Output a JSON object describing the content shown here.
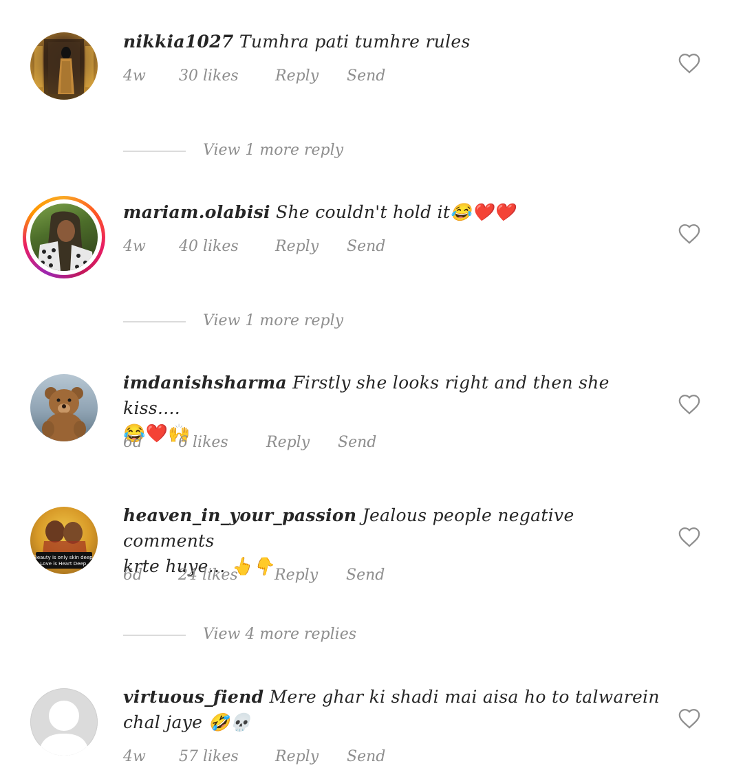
{
  "comments": [
    {
      "username": "nikkia1027",
      "text": "Tumhra pati tumhre rules",
      "time": "4w",
      "likes": "30 likes",
      "reply": "Reply",
      "send": "Send",
      "view_replies": "View 1 more reply"
    },
    {
      "username": "mariam.olabisi",
      "text": "She couldn't hold it😂❤️❤️",
      "time": "4w",
      "likes": "40 likes",
      "reply": "Reply",
      "send": "Send",
      "view_replies": "View 1 more reply"
    },
    {
      "username": "imdanishsharma",
      "text": "Firstly she looks right and then she kiss....",
      "text2": "😂❤️🙌",
      "time": "6d",
      "likes": "6 likes",
      "reply": "Reply",
      "send": "Send"
    },
    {
      "username": "heaven_in_your_passion",
      "text": "Jealous people negative comments",
      "text2": "krte huye... 👆👇",
      "time": "6d",
      "likes": "24 likes",
      "reply": "Reply",
      "send": "Send",
      "view_replies": "View 4 more replies",
      "avatar_caption": "Beauty is only skin deep; Love is Heart Deep."
    },
    {
      "username": "virtuous_fiend",
      "text": "Mere ghar ki shadi mai aisa ho to talwarein",
      "text2": "chal jaye 🤣💀",
      "time": "4w",
      "likes": "57 likes",
      "reply": "Reply",
      "send": "Send"
    }
  ],
  "colors": {
    "text": "#262626",
    "secondary": "#8e8e8e",
    "divider": "#dbdbdb"
  },
  "icons": {
    "heart": "heart-outline-icon"
  }
}
